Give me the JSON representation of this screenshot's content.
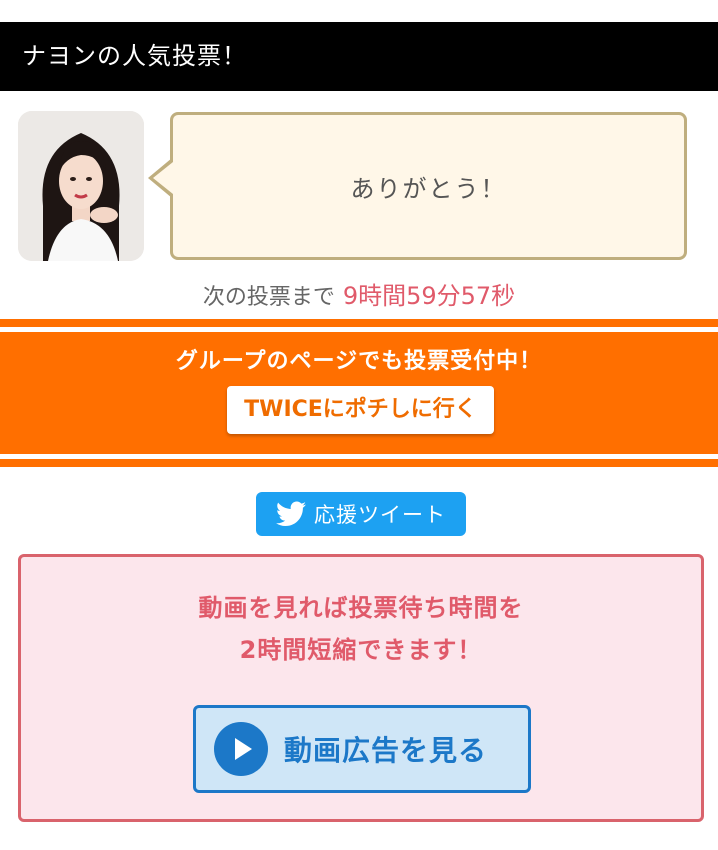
{
  "header": {
    "title": "ナヨンの人気投票！"
  },
  "message": {
    "text": "ありがとう！"
  },
  "next_vote": {
    "label": "次の投票まで",
    "countdown": "9時間59分57秒"
  },
  "group_banner": {
    "text": "グループのページでも投票受付中！",
    "button_label": "TWICEにポチしに行く"
  },
  "tweet": {
    "label": "応援ツイート",
    "icon": "twitter-bird-icon"
  },
  "ad": {
    "line1": "動画を見れば投票待ち時間を",
    "line2": "2時間短縮できます！",
    "button_label": "動画広告を見る",
    "icon": "play-icon"
  },
  "colors": {
    "header_bg": "#000000",
    "banner_bg": "#ff6f00",
    "countdown": "#e05a6a",
    "tweet_bg": "#1da1f2",
    "ad_border": "#d9636c",
    "ad_button": "#1c78c8"
  }
}
